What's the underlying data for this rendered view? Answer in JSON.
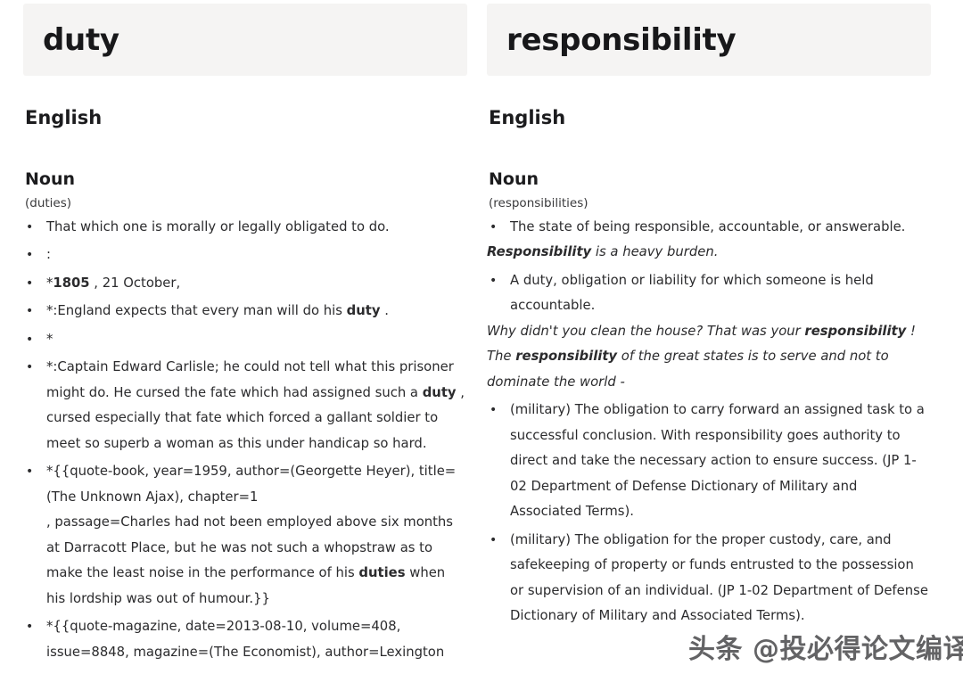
{
  "watermark": {
    "text": "头条 @投必得论文编译"
  },
  "theme": {
    "headword_box_bg": "#f5f4f3",
    "text_color": "#2b2b2d",
    "heading_color": "#1c1c1e",
    "page_bg": "#ffffff"
  },
  "columns": [
    {
      "headword": "duty",
      "language": "English",
      "part_of_speech": "Noun",
      "inflection": "(duties)",
      "entries": [
        {
          "kind": "sense",
          "html": "That which one is morally or legally obligated to do."
        },
        {
          "kind": "sense",
          "html": ":"
        },
        {
          "kind": "sense",
          "html": "*<b>1805</b> , 21 October,"
        },
        {
          "kind": "sense",
          "html": "*:England expects that every man will do his <b>duty</b> ."
        },
        {
          "kind": "sense",
          "html": "*"
        },
        {
          "kind": "sense",
          "html": "*:Captain Edward Carlisle; he could not tell what this prisoner might do. He cursed the fate which had assigned such a <b>duty</b> , cursed especially that fate which forced a gallant soldier to meet so superb a woman as this under handicap so hard."
        },
        {
          "kind": "sense",
          "html": "*{{quote-book, year=1959, author=(Georgette Heyer), title=(The Unknown Ajax), chapter=1<br>, passage=Charles had not been employed above six months at Darracott Place, but he was not such a whopstraw as to make the least noise in the performance of his <b>duties</b> when his lordship was out of humour.}}"
        },
        {
          "kind": "sense",
          "html": "*{{quote-magazine, date=2013-08-10, volume=408, issue=8848, magazine=(The Economist), author=Lexington"
        }
      ]
    },
    {
      "headword": "responsibility",
      "language": "English",
      "part_of_speech": "Noun",
      "inflection": "(responsibilities)",
      "entries": [
        {
          "kind": "sense",
          "html": "The state of being responsible, accountable, or answerable."
        },
        {
          "kind": "example",
          "html": "<b>Responsibility</b> is a heavy burden."
        },
        {
          "kind": "sense",
          "html": "A duty, obligation or liability for which someone is held accountable."
        },
        {
          "kind": "example",
          "html": "Why didn't you clean the house? That was your <b>responsibility</b> !"
        },
        {
          "kind": "example",
          "html": "The <b>responsibility</b> of the great states is to serve and not to dominate the world -"
        },
        {
          "kind": "sense",
          "html": "(military) The obligation to carry forward an assigned task to a successful conclusion. With responsibility goes authority to direct and take the necessary action to ensure success. (JP 1-02 Department of Defense Dictionary of Military and Associated Terms)."
        },
        {
          "kind": "sense",
          "html": "(military) The obligation for the proper custody, care, and safekeeping of property or funds entrusted to the possession or supervision of an individual. (JP 1-02 Department of Defense Dictionary of Military and Associated Terms)."
        }
      ]
    }
  ]
}
